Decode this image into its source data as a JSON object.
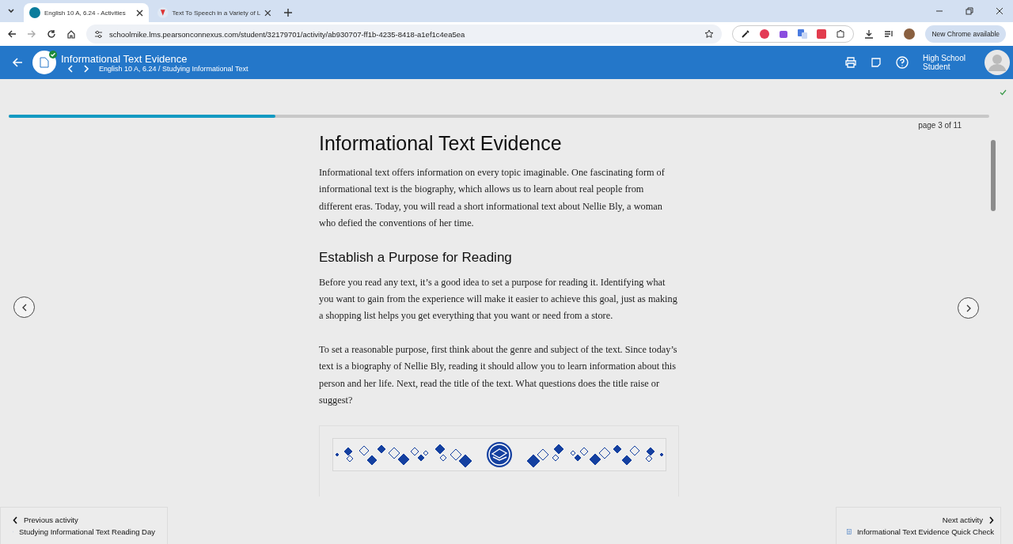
{
  "browser": {
    "tabs": [
      {
        "title": "English 10 A, 6.24 - Activities",
        "selected": true
      },
      {
        "title": "Text To Speech in a Variety of L",
        "selected": false
      }
    ],
    "url": "schoolmike.lms.pearsonconnexus.com/student/32179701/activity/ab930707-ff1b-4235-8418-a1ef1c4ea5ea",
    "update_button": "New Chrome available"
  },
  "header": {
    "title": "Informational Text Evidence",
    "breadcrumb": "English 10 A, 6.24 / Studying Informational Text",
    "completed": true,
    "user": "High School Student"
  },
  "progress": {
    "level": 0.272,
    "page_label": "page 3 of 11"
  },
  "article": {
    "title": "Informational Text Evidence",
    "intro": "Informational text offers information on every topic imaginable. One fascinating form of informational text is the biography, which allows us to learn about real people from different eras. Today, you will read a short informational text about Nellie Bly, a woman who defied the conventions of her time.",
    "subtitle": "Establish a Purpose for Reading",
    "paragraphs": [
      "Before you read any text, it’s a good idea to set a purpose for reading it. Identifying what you want to gain from the experience will make it easier to achieve this goal, just as making a shopping list helps you get everything that you want or need from a store.",
      "To set a reasonable purpose, first think about the genre and subject of the text. Since today’s text is a biography of Nellie Bly, reading it should allow you to learn information about this person and her life. Next, read the title of the text. What questions does the title raise or suggest?"
    ]
  },
  "footer": {
    "previous": {
      "label": "Previous activity",
      "title": "Studying Informational Text Reading Day"
    },
    "next": {
      "label": "Next activity",
      "title": "Informational Text Evidence Quick Check"
    }
  }
}
